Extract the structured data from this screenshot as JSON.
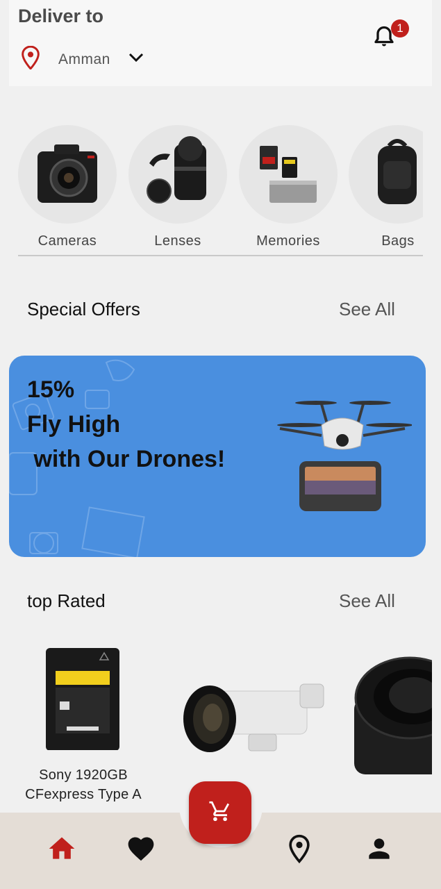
{
  "header": {
    "deliver_label": "Deliver to",
    "location": "Amman",
    "notification_count": "1"
  },
  "categories": [
    {
      "label": "Cameras",
      "icon": "camera-image"
    },
    {
      "label": "Lenses",
      "icon": "lens-image"
    },
    {
      "label": "Memories",
      "icon": "memory-card-image"
    },
    {
      "label": "Bags",
      "icon": "backpack-image"
    }
  ],
  "special_offers": {
    "title": "Special Offers",
    "see_all": "See All",
    "banner": {
      "line1": "15%",
      "line2": "Fly High",
      "line3": " with Our Drones!"
    }
  },
  "top_rated": {
    "title": "top Rated",
    "see_all": "See All",
    "products": [
      {
        "name_line1": "Sony 1920GB",
        "name_line2": "CFexpress Type A"
      }
    ]
  },
  "colors": {
    "accent": "#c0201c",
    "banner": "#4a8fdf",
    "background": "#f0f0f0"
  },
  "nav": [
    "home-icon",
    "heart-icon",
    "cart-icon",
    "map-pin-icon",
    "person-icon"
  ]
}
